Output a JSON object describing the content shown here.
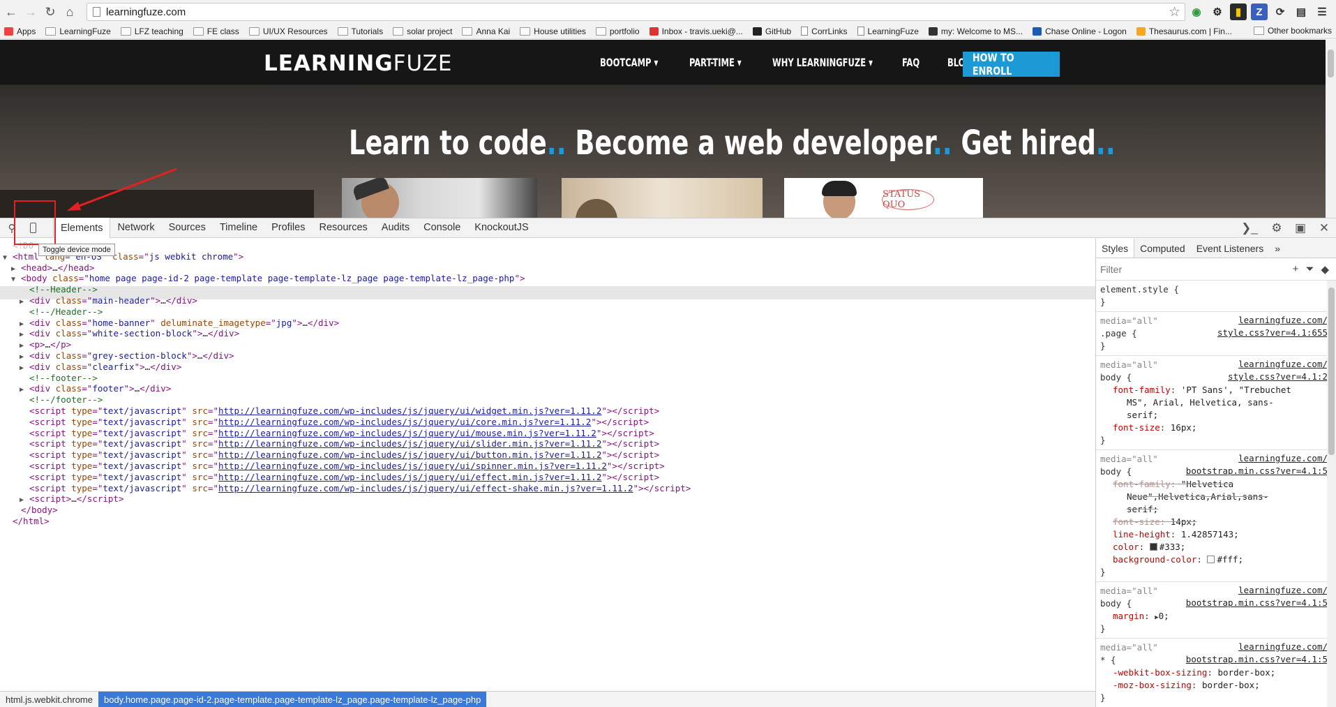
{
  "browser": {
    "url": "learningfuze.com",
    "bookmarks": [
      {
        "label": "Apps",
        "icon": "apps-grid-icon"
      },
      {
        "label": "LearningFuze",
        "icon": "folder-icon"
      },
      {
        "label": "LFZ teaching",
        "icon": "folder-icon"
      },
      {
        "label": "FE class",
        "icon": "folder-icon"
      },
      {
        "label": "UI/UX Resources",
        "icon": "folder-icon"
      },
      {
        "label": "Tutorials",
        "icon": "folder-icon"
      },
      {
        "label": "solar project",
        "icon": "folder-icon"
      },
      {
        "label": "Anna Kai",
        "icon": "folder-icon"
      },
      {
        "label": "House utilities",
        "icon": "folder-icon"
      },
      {
        "label": "portfolio",
        "icon": "folder-icon"
      },
      {
        "label": "Inbox - travis.ueki@...",
        "icon": "gmail-icon"
      },
      {
        "label": "GitHub",
        "icon": "github-icon"
      },
      {
        "label": "CorrLinks",
        "icon": "page-icon"
      },
      {
        "label": "LearningFuze",
        "icon": "page-icon"
      },
      {
        "label": "my: Welcome to MS...",
        "icon": "bb-icon"
      },
      {
        "label": "Chase Online - Logon",
        "icon": "chase-icon"
      },
      {
        "label": "Thesaurus.com | Fin...",
        "icon": "thesaurus-icon"
      }
    ],
    "other_bookmarks": "Other bookmarks"
  },
  "site": {
    "logo_bold": "LEARNING",
    "logo_light": "FUZE",
    "nav": [
      "BOOTCAMP",
      "PART-TIME",
      "WHY LEARNINGFUZE",
      "FAQ",
      "BLOG"
    ],
    "enroll": "HOW TO ENROLL",
    "hero": {
      "p1": "Learn to code",
      "p2": "Become a web developer",
      "p3": "Get hired",
      "dots": ".."
    },
    "status_quo": "STATUS QUO"
  },
  "devtools": {
    "tabs": [
      "Elements",
      "Network",
      "Sources",
      "Timeline",
      "Profiles",
      "Resources",
      "Audits",
      "Console",
      "KnockoutJS"
    ],
    "active_tab": "Elements",
    "tooltip": "Toggle device mode",
    "doctype_fragment": "<!DO",
    "dom": {
      "html_lang": "en-US",
      "html_class": "js webkit chrome",
      "body_class": "home page page-id-2 page-template page-template-lz_page page-template-lz_page-php",
      "header_comment": "<!--Header-->",
      "header_end_comment": "<!--/Header-->",
      "footer_comment": "<!--footer-->",
      "footer_end_comment": "<!--/footer-->",
      "divs": [
        {
          "class": "main-header"
        },
        {
          "class": "home-banner",
          "extra_attr": "deluminate_imagetype",
          "extra_val": "jpg"
        },
        {
          "class": "white-section-block"
        },
        {
          "class": "grey-section-block"
        },
        {
          "class": "clearfix"
        },
        {
          "class": "footer"
        }
      ],
      "script_type": "text/javascript",
      "scripts": [
        "http://learningfuze.com/wp-includes/js/jquery/ui/widget.min.js?ver=1.11.2",
        "http://learningfuze.com/wp-includes/js/jquery/ui/core.min.js?ver=1.11.2",
        "http://learningfuze.com/wp-includes/js/jquery/ui/mouse.min.js?ver=1.11.2",
        "http://learningfuze.com/wp-includes/js/jquery/ui/slider.min.js?ver=1.11.2",
        "http://learningfuze.com/wp-includes/js/jquery/ui/button.min.js?ver=1.11.2",
        "http://learningfuze.com/wp-includes/js/jquery/ui/spinner.min.js?ver=1.11.2",
        "http://learningfuze.com/wp-includes/js/jquery/ui/effect.min.js?ver=1.11.2",
        "http://learningfuze.com/wp-includes/js/jquery/ui/effect-shake.min.js?ver=1.11.2"
      ]
    },
    "breadcrumb": [
      "html.js.webkit.chrome",
      "body.home.page.page-id-2.page-template.page-template-lz_page.page-template-lz_page-php"
    ],
    "styles_pane": {
      "tabs": [
        "Styles",
        "Computed",
        "Event Listeners"
      ],
      "filter_placeholder": "Filter",
      "rules": [
        {
          "selector": "element.style {",
          "media": "",
          "src": "",
          "lines": []
        },
        {
          "selector": ".page {",
          "media": "media=\"all\"",
          "src1": "learningfuze.com/",
          "src2": "style.css?ver=4.1:655",
          "lines": []
        },
        {
          "selector": "body {",
          "media": "media=\"all\"",
          "src1": "learningfuze.com/",
          "src2": "style.css?ver=4.1:2",
          "lines": [
            [
              "font-family",
              "'PT Sans', \"Trebuchet"
            ],
            [
              "",
              "MS\", Arial, Helvetica, sans-"
            ],
            [
              "",
              "serif;"
            ],
            [
              "font-size",
              "16px;"
            ]
          ]
        },
        {
          "selector": "body {",
          "media": "media=\"all\"",
          "src1": "learningfuze.com/",
          "src2": "bootstrap.min.css?ver=4.1:5",
          "lines": [
            [
              "font-family",
              "\"Helvetica"
            ],
            [
              "",
              "Neue\",Helvetica,Arial,sans-"
            ],
            [
              "",
              "serif;"
            ],
            [
              "font-size",
              "14px;"
            ],
            [
              "line-height",
              "1.42857143;"
            ],
            [
              "color",
              "#333;"
            ],
            [
              "background-color",
              "#fff;"
            ]
          ]
        },
        {
          "selector": "body {",
          "media": "media=\"all\"",
          "src1": "learningfuze.com/",
          "src2": "bootstrap.min.css?ver=4.1:5",
          "lines": [
            [
              "margin",
              "0;"
            ]
          ]
        },
        {
          "selector": "* {",
          "media": "media=\"all\"",
          "src1": "learningfuze.com/",
          "src2": "bootstrap.min.css?ver=4.1:5",
          "lines": [
            [
              "-webkit-box-sizing",
              "border-box;"
            ],
            [
              "-moz-box-sizing",
              "border-box;"
            ]
          ]
        }
      ]
    }
  },
  "colors": {
    "accent": "#1b9ad6",
    "annotation": "#e32121",
    "selection": "#3879d9"
  }
}
